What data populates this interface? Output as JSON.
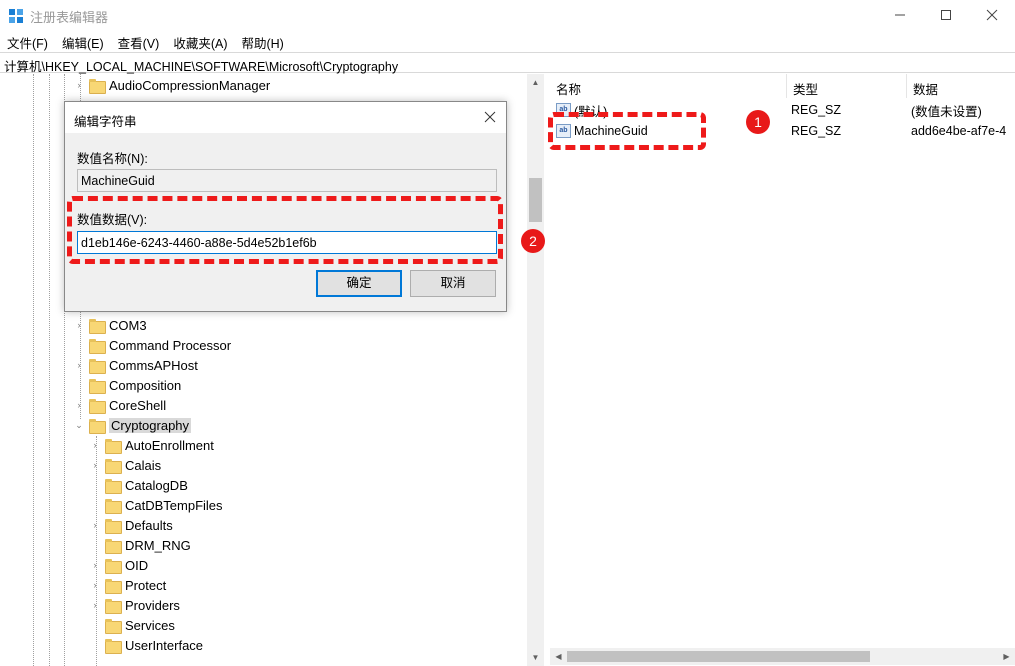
{
  "window": {
    "title": "注册表编辑器",
    "menu": [
      "文件(F)",
      "编辑(E)",
      "查看(V)",
      "收藏夹(A)",
      "帮助(H)"
    ],
    "address": "计算机\\HKEY_LOCAL_MACHINE\\SOFTWARE\\Microsoft\\Cryptography"
  },
  "tree": {
    "items": [
      {
        "label": "AudioCompressionManager",
        "expand": "›"
      },
      {
        "label": "COM3",
        "expand": "›"
      },
      {
        "label": "Command Processor",
        "expand": ""
      },
      {
        "label": "CommsAPHost",
        "expand": "›"
      },
      {
        "label": "Composition",
        "expand": ""
      },
      {
        "label": "CoreShell",
        "expand": "›"
      },
      {
        "label": "Cryptography",
        "expand": "⌄"
      }
    ],
    "children": [
      {
        "label": "AutoEnrollment",
        "expand": "›"
      },
      {
        "label": "Calais",
        "expand": "›"
      },
      {
        "label": "CatalogDB",
        "expand": ""
      },
      {
        "label": "CatDBTempFiles",
        "expand": ""
      },
      {
        "label": "Defaults",
        "expand": "›"
      },
      {
        "label": "DRM_RNG",
        "expand": ""
      },
      {
        "label": "OID",
        "expand": "›"
      },
      {
        "label": "Protect",
        "expand": "›"
      },
      {
        "label": "Providers",
        "expand": "›"
      },
      {
        "label": "Services",
        "expand": ""
      },
      {
        "label": "UserInterface",
        "expand": ""
      }
    ]
  },
  "values_pane": {
    "headers": {
      "name": "名称",
      "type": "类型",
      "data": "数据"
    },
    "rows": [
      {
        "name": "(默认)",
        "type": "REG_SZ",
        "data": "(数值未设置)"
      },
      {
        "name": "MachineGuid",
        "type": "REG_SZ",
        "data": "add6e4be-af7e-4"
      }
    ]
  },
  "dialog": {
    "title": "编辑字符串",
    "name_label": "数值名称(N):",
    "name_value": "MachineGuid",
    "data_label": "数值数据(V):",
    "data_value": "d1eb146e-6243-4460-a88e-5d4e52b1ef6b",
    "ok_label": "确定",
    "cancel_label": "取消"
  },
  "annotations": {
    "badge1": "1",
    "badge2": "2",
    "color": "#e81919"
  },
  "colors": {
    "folder": "#f8d775",
    "accent": "#0078d7"
  }
}
